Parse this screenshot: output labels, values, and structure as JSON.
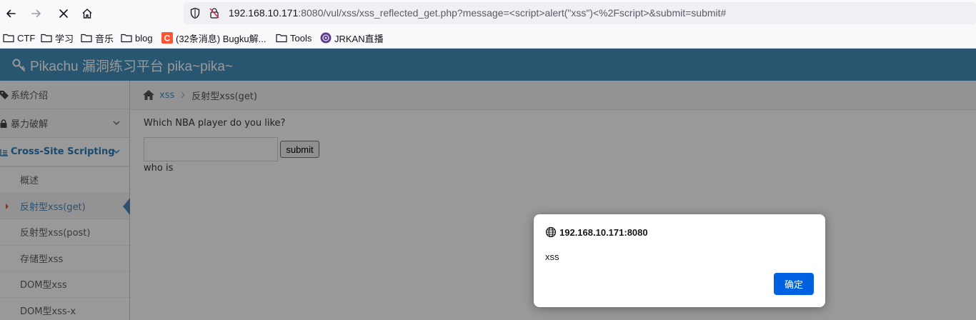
{
  "browser": {
    "url_host": "192.168.10.171",
    "url_rest": ":8080/vul/xss/xss_reflected_get.php?message=<script>alert(\"xss\")<%2Fscript>&submit=submit#",
    "bookmarks": [
      {
        "icon": "folder-icon",
        "label": "CTF"
      },
      {
        "icon": "folder-icon",
        "label": "学习"
      },
      {
        "icon": "folder-icon",
        "label": "音乐"
      },
      {
        "icon": "folder-icon",
        "label": "blog"
      },
      {
        "icon": "csdn-icon",
        "label": "(32条消息) Bugku解..."
      },
      {
        "icon": "folder-icon",
        "label": "Tools"
      },
      {
        "icon": "jrkan-icon",
        "label": "JRKAN直播"
      }
    ]
  },
  "app": {
    "brand": "Pikachu 漏洞练习平台 pika~pika~",
    "header_color": "#438eb9",
    "accent_color": "#4b88b7"
  },
  "sidebar": {
    "items": [
      {
        "icon": "tags-icon",
        "label": "系统介绍"
      },
      {
        "icon": "lock-icon",
        "label": "暴力破解"
      },
      {
        "icon": "list-icon",
        "label": "Cross-Site Scripting"
      }
    ],
    "subitems": [
      {
        "label": "概述"
      },
      {
        "label": "反射型xss(get)"
      },
      {
        "label": "反射型xss(post)"
      },
      {
        "label": "存储型xss"
      },
      {
        "label": "DOM型xss"
      },
      {
        "label": "DOM型xss-x"
      }
    ]
  },
  "breadcrumb": {
    "link": "xss",
    "current": "反射型xss(get)"
  },
  "form": {
    "question": "Which NBA player do you like?",
    "input_value": "",
    "submit_label": "submit",
    "result_text": "who is"
  },
  "dialog": {
    "origin": "192.168.10.171:8080",
    "message": "xss",
    "ok_label": "确定"
  }
}
